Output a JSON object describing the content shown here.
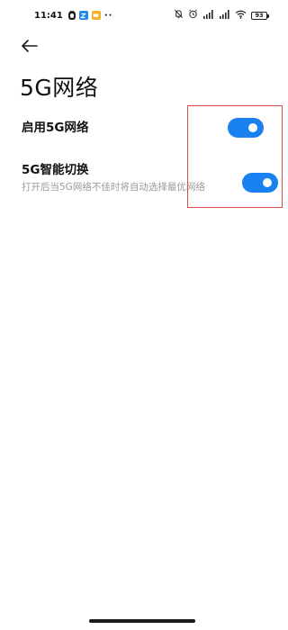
{
  "status_bar": {
    "time": "11:41",
    "dots": "··",
    "battery": "93"
  },
  "header": {
    "title": "5G网络"
  },
  "settings": [
    {
      "label": "启用5G网络",
      "description": "",
      "enabled": true
    },
    {
      "label": "5G智能切换",
      "description": "打开后当5G网络不佳时将自动选择最优网络",
      "enabled": true
    }
  ],
  "colors": {
    "toggle_on": "#1a82f0",
    "highlight": "#d9504a"
  },
  "icons": {
    "back": "back-arrow-icon"
  }
}
